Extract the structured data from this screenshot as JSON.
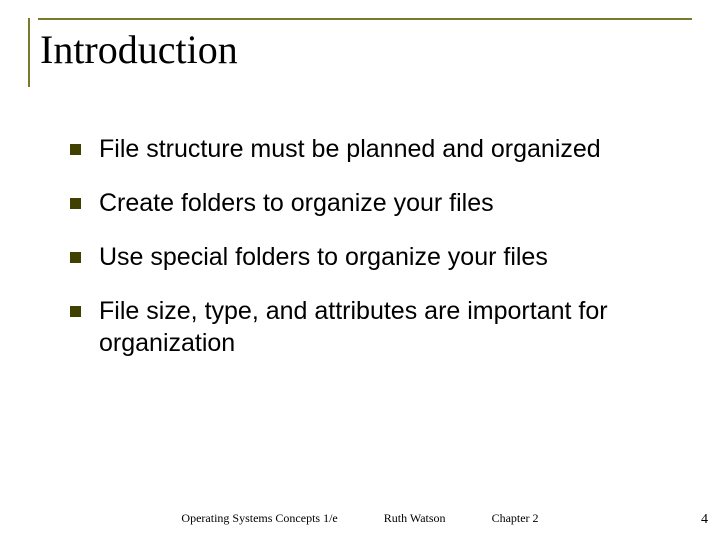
{
  "title": "Introduction",
  "bullets": [
    "File structure must be planned and organized",
    "Create folders to organize your files",
    "Use special folders to organize your files",
    "File size, type, and attributes are important for organization"
  ],
  "footer": {
    "left": "Operating Systems Concepts 1/e",
    "center": "Ruth Watson",
    "right": "Chapter 2"
  },
  "page_number": "4"
}
